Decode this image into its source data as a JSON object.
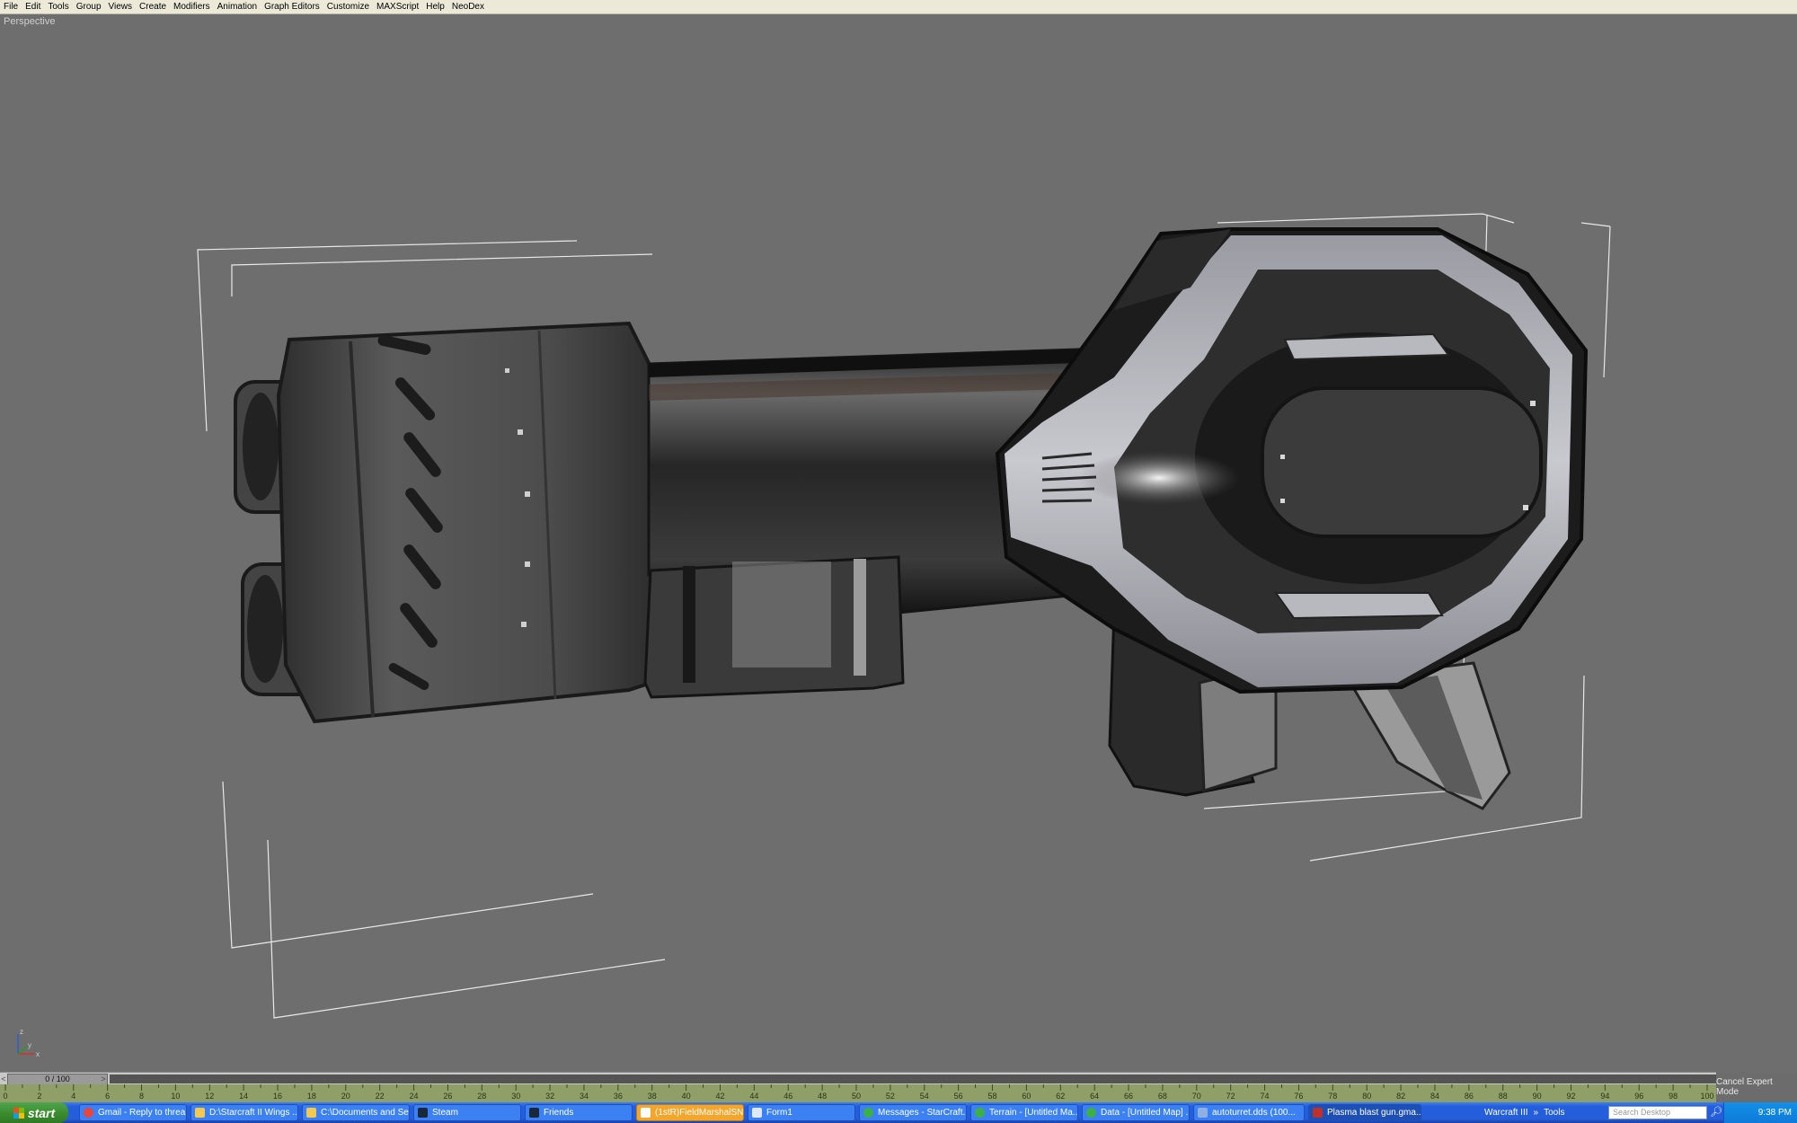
{
  "menu": [
    "File",
    "Edit",
    "Tools",
    "Group",
    "Views",
    "Create",
    "Modifiers",
    "Animation",
    "Graph Editors",
    "Customize",
    "MAXScript",
    "Help",
    "NeoDex"
  ],
  "viewport": {
    "label": "Perspective",
    "background": "#6e6e6e"
  },
  "axis": {
    "x": "x",
    "y": "y",
    "z": "z"
  },
  "timeslider": {
    "prev": "<",
    "frame_label": "0 / 100",
    "next": ">"
  },
  "ruler": {
    "ticks": [
      "0",
      "2",
      "4",
      "6",
      "8",
      "10",
      "12",
      "14",
      "16",
      "18",
      "20",
      "22",
      "24",
      "26",
      "28",
      "30",
      "32",
      "34",
      "36",
      "38",
      "40",
      "42",
      "44",
      "46",
      "48",
      "50",
      "52",
      "54",
      "56",
      "58",
      "60",
      "62",
      "64",
      "66",
      "68",
      "70",
      "72",
      "74",
      "76",
      "78",
      "80",
      "82",
      "84",
      "86",
      "88",
      "90",
      "92",
      "94",
      "96",
      "98",
      "100"
    ]
  },
  "cancel_expert": "Cancel Expert Mode",
  "taskbar": {
    "start": "start",
    "tasks": [
      {
        "label": "Gmail - Reply to threa...",
        "icon": "chrome-icon"
      },
      {
        "label": "D:\\Starcraft II Wings ...",
        "icon": "folder-icon"
      },
      {
        "label": "C:\\Documents and Se...",
        "icon": "folder-icon"
      },
      {
        "label": "Steam",
        "icon": "steam-icon"
      },
      {
        "label": "Friends",
        "icon": "steam-icon"
      },
      {
        "label": "(1stR)FieldMarshalSN...",
        "icon": "chat-icon"
      },
      {
        "label": "Form1",
        "icon": "window-icon"
      },
      {
        "label": "Messages - StarCraft...",
        "icon": "globe-icon"
      },
      {
        "label": "Terrain - [Untitled Ma...",
        "icon": "globe-icon"
      },
      {
        "label": "Data - [Untitled Map] ...",
        "icon": "globe-icon"
      },
      {
        "label": "autoturret.dds (100...",
        "icon": "image-icon"
      },
      {
        "label": "Plasma blast gun.gma...",
        "icon": "max-icon"
      }
    ],
    "quicktools": [
      "Warcraft III",
      "»",
      "Tools"
    ],
    "search_placeholder": "Search Desktop",
    "clock": "9:38 PM"
  }
}
